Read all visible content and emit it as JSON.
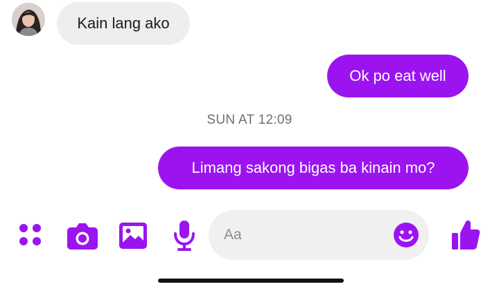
{
  "conversation": {
    "messages": [
      {
        "direction": "incoming",
        "text": "Kain lang ako"
      },
      {
        "direction": "outgoing",
        "text": "Ok po eat well"
      },
      {
        "direction": "outgoing",
        "text": "Limang sakong bigas ba kinain mo?"
      }
    ],
    "timestamp": "SUN AT 12:09"
  },
  "composer": {
    "placeholder": "Aa"
  },
  "toolbar": {
    "icons": [
      "apps-icon",
      "camera-icon",
      "image-icon",
      "microphone-icon",
      "emoji-icon",
      "thumbs-up-icon"
    ]
  },
  "colors": {
    "accent": "#9b14f0",
    "incoming_bubble": "#efeeee",
    "timestamp_text": "#6f6f6f"
  }
}
